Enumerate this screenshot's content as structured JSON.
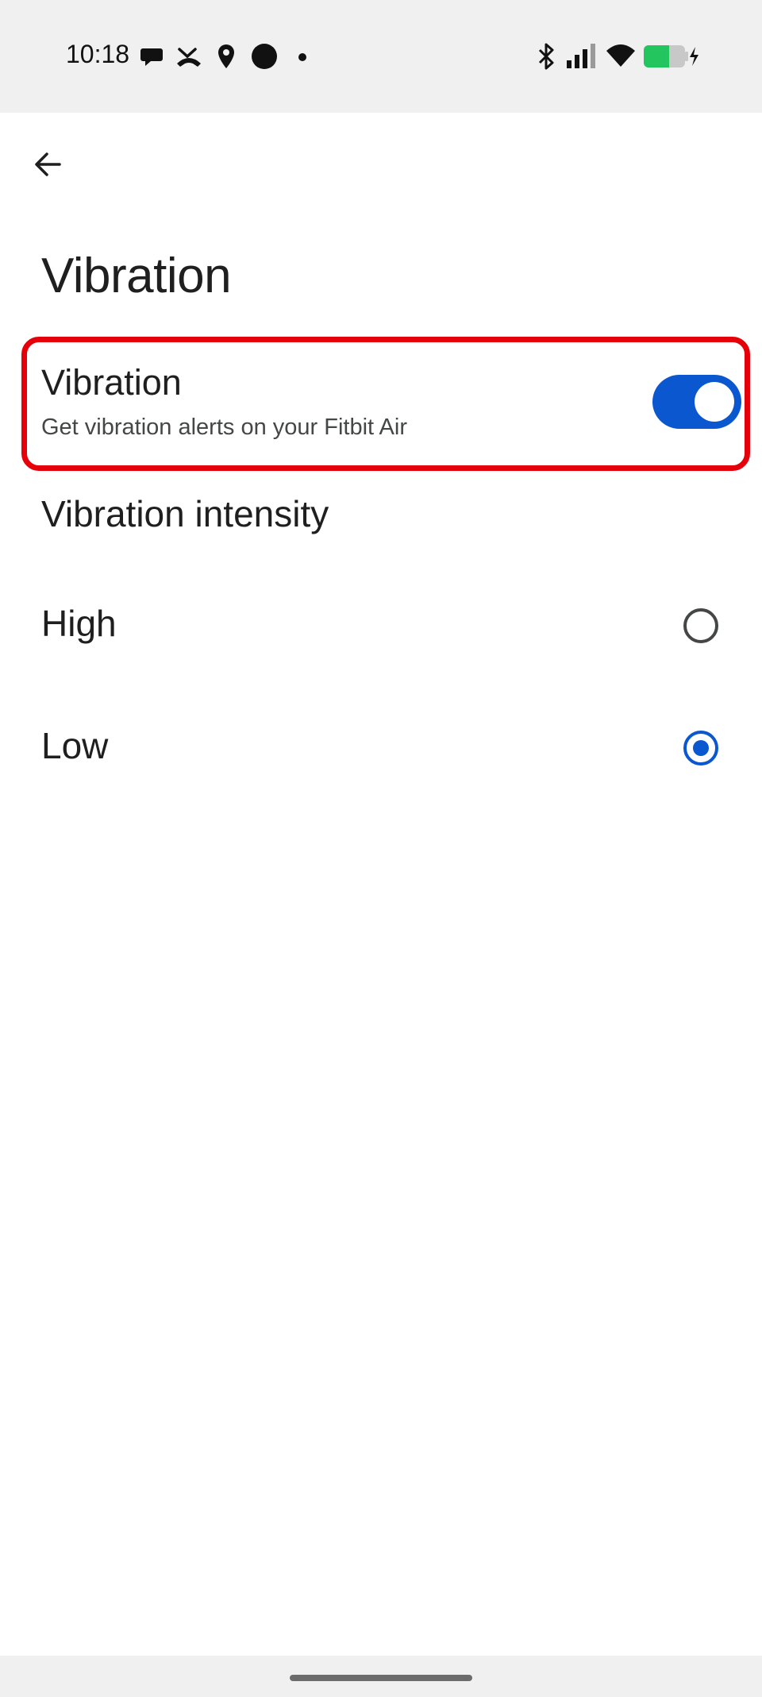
{
  "status_bar": {
    "time": "10:18",
    "left_icons": [
      "chat-bubble-icon",
      "missed-call-icon",
      "location-pin-icon",
      "filled-circle-icon",
      "dot-icon"
    ],
    "right_icons": [
      "bluetooth-icon",
      "signal-bars-icon",
      "wifi-icon",
      "battery-charging-icon"
    ],
    "battery_color": "#22c55e"
  },
  "nav": {
    "back_icon": "arrow-back-icon"
  },
  "page": {
    "title": "Vibration"
  },
  "vibration_setting": {
    "title": "Vibration",
    "subtitle": "Get vibration alerts on your Fitbit Air",
    "enabled": true,
    "highlight_color": "#e6000a"
  },
  "intensity": {
    "header": "Vibration intensity",
    "options": [
      {
        "label": "High",
        "selected": false
      },
      {
        "label": "Low",
        "selected": true
      }
    ]
  },
  "colors": {
    "accent": "#0b57d0",
    "text_primary": "#1f1f1f",
    "text_secondary": "#444746",
    "system_bar": "#f0f0f0"
  }
}
